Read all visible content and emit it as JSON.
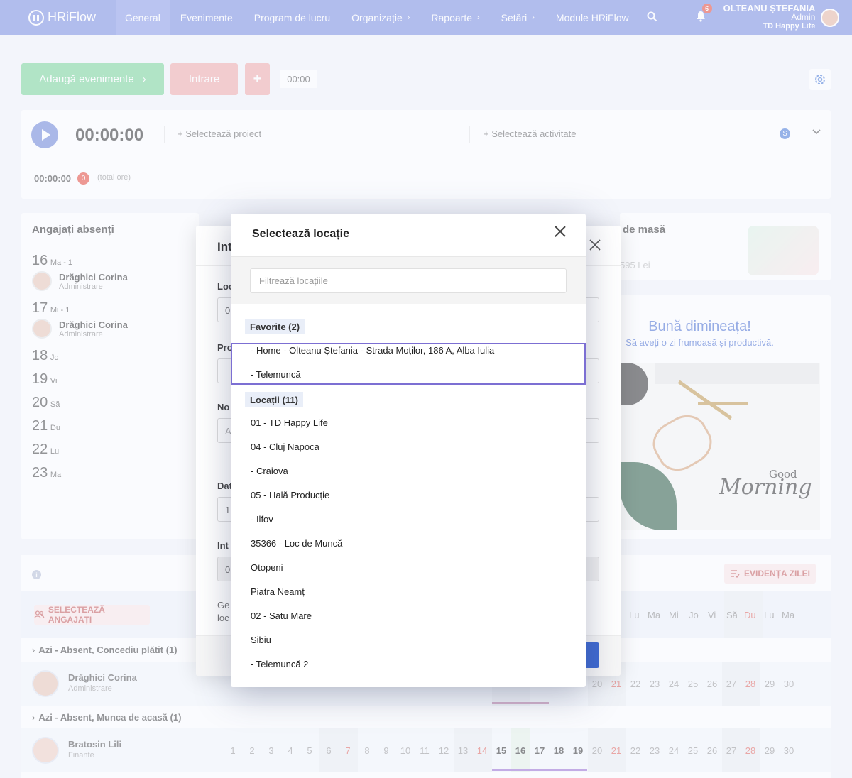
{
  "nav": {
    "logo": "HRiFlow",
    "items": [
      {
        "label": "General",
        "chev": ""
      },
      {
        "label": "Evenimente",
        "chev": ""
      },
      {
        "label": "Program de lucru",
        "chev": ""
      },
      {
        "label": "Organizație",
        "chev": "›"
      },
      {
        "label": "Rapoarte",
        "chev": "›"
      },
      {
        "label": "Setări",
        "chev": "›"
      },
      {
        "label": "Module HRiFlow",
        "chev": ""
      }
    ],
    "notifications": "6",
    "user": {
      "name": "OLTEANU ȘTEFANIA",
      "role": "Admin",
      "company": "TD Happy Life"
    }
  },
  "actions": {
    "add_events": "Adaugă evenimente",
    "add_chev": "›",
    "entry": "Intrare",
    "plus": "+",
    "time": "00:00"
  },
  "timer": {
    "time": "00:00:00",
    "select_project": "+ Selectează proiect",
    "select_activity": "+ Selectează activitate",
    "total_time": "00:00:00",
    "total_count": "0",
    "total_label": "(total ore)"
  },
  "absent": {
    "title": "Angajați absenți",
    "days": [
      {
        "num": "16",
        "label": "Ma - 1"
      },
      {
        "num": "17",
        "label": "Mi - 1"
      },
      {
        "num": "18",
        "label": "Jo"
      },
      {
        "num": "19",
        "label": "Vi"
      },
      {
        "num": "20",
        "label": "Să"
      },
      {
        "num": "21",
        "label": "Du"
      },
      {
        "num": "22",
        "label": "Lu"
      },
      {
        "num": "23",
        "label": "Ma"
      }
    ],
    "people": [
      {
        "name": "Drăghici Corina",
        "dept": "Administrare"
      },
      {
        "name": "Drăghici Corina",
        "dept": "Administrare"
      }
    ]
  },
  "lunch": {
    "title_partial": "de masă",
    "value_partial": "595 Lei"
  },
  "morning": {
    "title": "Bună dimineața!",
    "subtitle": "Să aveți o zi frumoasă și productivă.",
    "image_good": "Good",
    "image_morning": "Morning"
  },
  "calendar": {
    "select_employees": "SELECTEAZĂ ANGAJAȚI",
    "day_evidence": "EVIDENȚA ZILEI",
    "weekday_heads": [
      "Lu",
      "Ma",
      "Mi",
      "Jo",
      "Vi",
      "Să",
      "Du",
      "Lu",
      "Ma"
    ],
    "groups": [
      "Azi - Absent, Concediu plătit (1)",
      "Azi - Absent, Munca de acasă (1)"
    ],
    "employees": [
      {
        "name": "Drăghici Corina",
        "dept": "Administrare",
        "days": [
          "20",
          "21",
          "22",
          "23",
          "24",
          "25",
          "26",
          "27",
          "28",
          "29",
          "30"
        ]
      },
      {
        "name": "Bratosin Lili",
        "dept": "Finanțe",
        "days": [
          "1",
          "2",
          "3",
          "4",
          "5",
          "6",
          "7",
          "8",
          "9",
          "10",
          "11",
          "12",
          "13",
          "14",
          "15",
          "16",
          "17",
          "18",
          "19",
          "20",
          "21",
          "22",
          "23",
          "24",
          "25",
          "26",
          "27",
          "28",
          "29",
          "30"
        ]
      }
    ]
  },
  "back_modal": {
    "title_partial": "Int",
    "labels": [
      "Loc",
      "Pro",
      "No",
      "Dat",
      "Int"
    ],
    "input_values": [
      "0",
      "",
      "A",
      "1",
      "0"
    ],
    "note_lines": [
      "Ge",
      "loc"
    ]
  },
  "location_picker": {
    "title": "Selectează locație",
    "filter_placeholder": "Filtrează locațiile",
    "favorites_label": "Favorite (2)",
    "favorites": [
      "- Home - Olteanu Ștefania - Strada Moților, 186 A, Alba Iulia",
      "- Telemuncă"
    ],
    "locations_label": "Locații (11)",
    "locations": [
      "01 - TD Happy Life",
      "04 - Cluj Napoca",
      "- Craiova",
      "05 - Hală Producție",
      "- Ilfov",
      "35366 - Loc de Muncă",
      "Otopeni",
      "Piatra Neamț",
      "02 - Satu Mare",
      "Sibiu",
      "- Telemuncă 2"
    ]
  }
}
